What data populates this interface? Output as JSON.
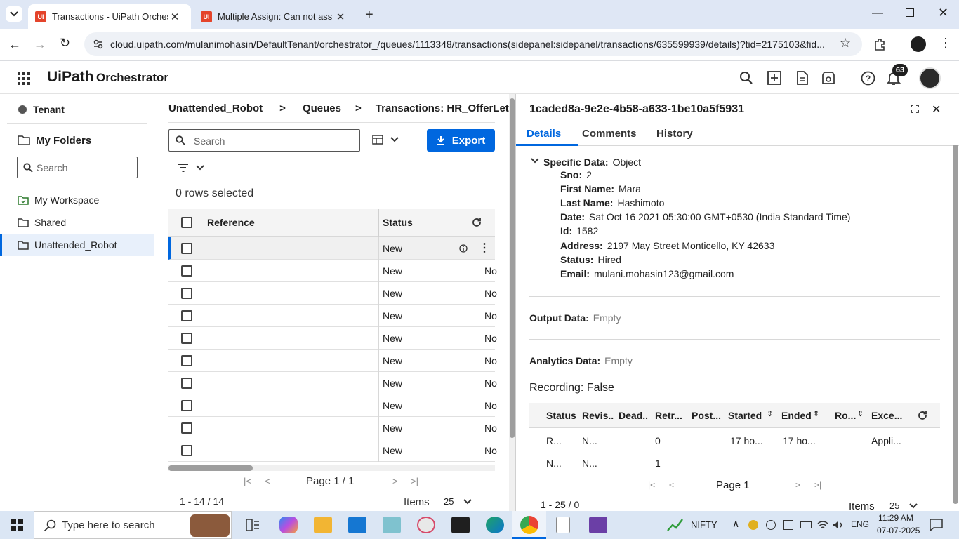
{
  "browser": {
    "tabs": [
      {
        "title": "Transactions - UiPath Orchestra",
        "favicon": "Ui"
      },
      {
        "title": "Multiple Assign: Can not assign",
        "favicon": "Ui"
      }
    ],
    "url": "cloud.uipath.com/mulanimohasin/DefaultTenant/orchestrator_/queues/1113348/transactions(sidepanel:sidepanel/transactions/635599939/details)?tid=2175103&fid..."
  },
  "app": {
    "brand": "UiPath",
    "product": "Orchestrator",
    "notification_count": "63",
    "accent_color": "#0067df"
  },
  "nav": {
    "tenant": "Tenant",
    "my_folders": "My Folders",
    "search_placeholder": "Search",
    "items": [
      {
        "label": "My Workspace",
        "icon": "folder-workspace-icon"
      },
      {
        "label": "Shared",
        "icon": "folder-icon"
      },
      {
        "label": "Unattended_Robot",
        "icon": "folder-icon"
      }
    ]
  },
  "breadcrumb": [
    "Unattended_Robot",
    "Queues",
    "Transactions: HR_OfferLette"
  ],
  "list": {
    "search_placeholder": "Search",
    "export_label": "Export",
    "rows_selected": "0 rows selected",
    "headers": {
      "reference": "Reference",
      "status": "Status"
    },
    "rows": [
      {
        "status": "New",
        "extra": ""
      },
      {
        "status": "New",
        "extra": "No"
      },
      {
        "status": "New",
        "extra": "No"
      },
      {
        "status": "New",
        "extra": "No"
      },
      {
        "status": "New",
        "extra": "No"
      },
      {
        "status": "New",
        "extra": "No"
      },
      {
        "status": "New",
        "extra": "No"
      },
      {
        "status": "New",
        "extra": "No"
      },
      {
        "status": "New",
        "extra": "No"
      },
      {
        "status": "New",
        "extra": "No"
      }
    ],
    "page": "Page 1 / 1",
    "range": "1 - 14 / 14",
    "items_label": "Items",
    "items_value": "25"
  },
  "detail": {
    "id": "1caded8a-9e2e-4b58-a633-1be10a5f5931",
    "tabs": [
      "Details",
      "Comments",
      "History"
    ],
    "specific_label": "Specific Data:",
    "specific_value": "Object",
    "fields": [
      {
        "k": "Sno:",
        "v": "2"
      },
      {
        "k": "First Name:",
        "v": "Mara"
      },
      {
        "k": "Last Name:",
        "v": "Hashimoto"
      },
      {
        "k": "Date:",
        "v": "Sat Oct 16 2021 05:30:00 GMT+0530 (India Standard Time)"
      },
      {
        "k": "Id:",
        "v": "1582"
      },
      {
        "k": "Address:",
        "v": "2197 May Street Monticello, KY 42633"
      },
      {
        "k": "Status:",
        "v": "Hired"
      },
      {
        "k": "Email:",
        "v": "mulani.mohasin123@gmail.com"
      }
    ],
    "output_label": "Output Data:",
    "output_value": "Empty",
    "analytics_label": "Analytics Data:",
    "analytics_value": "Empty",
    "recording": "Recording: False",
    "table_headers": [
      "Status",
      "Revis..",
      "Dead..",
      "Retr...",
      "Post...",
      "Started",
      "Ended",
      "Ro...",
      "Exce..."
    ],
    "table_rows": [
      [
        "R...",
        "N...",
        "",
        "0",
        "",
        "17 ho...",
        "17 ho...",
        "",
        "Appli..."
      ],
      [
        "N...",
        "N...",
        "",
        "1",
        "",
        "",
        "",
        "",
        ""
      ]
    ],
    "page": "Page 1",
    "range": "1 - 25 / 0",
    "items_label": "Items",
    "items_value": "25"
  },
  "taskbar": {
    "search_placeholder": "Type here to search",
    "nifty": "NIFTY",
    "lang": "ENG",
    "time": "11:29 AM",
    "date": "07-07-2025"
  }
}
